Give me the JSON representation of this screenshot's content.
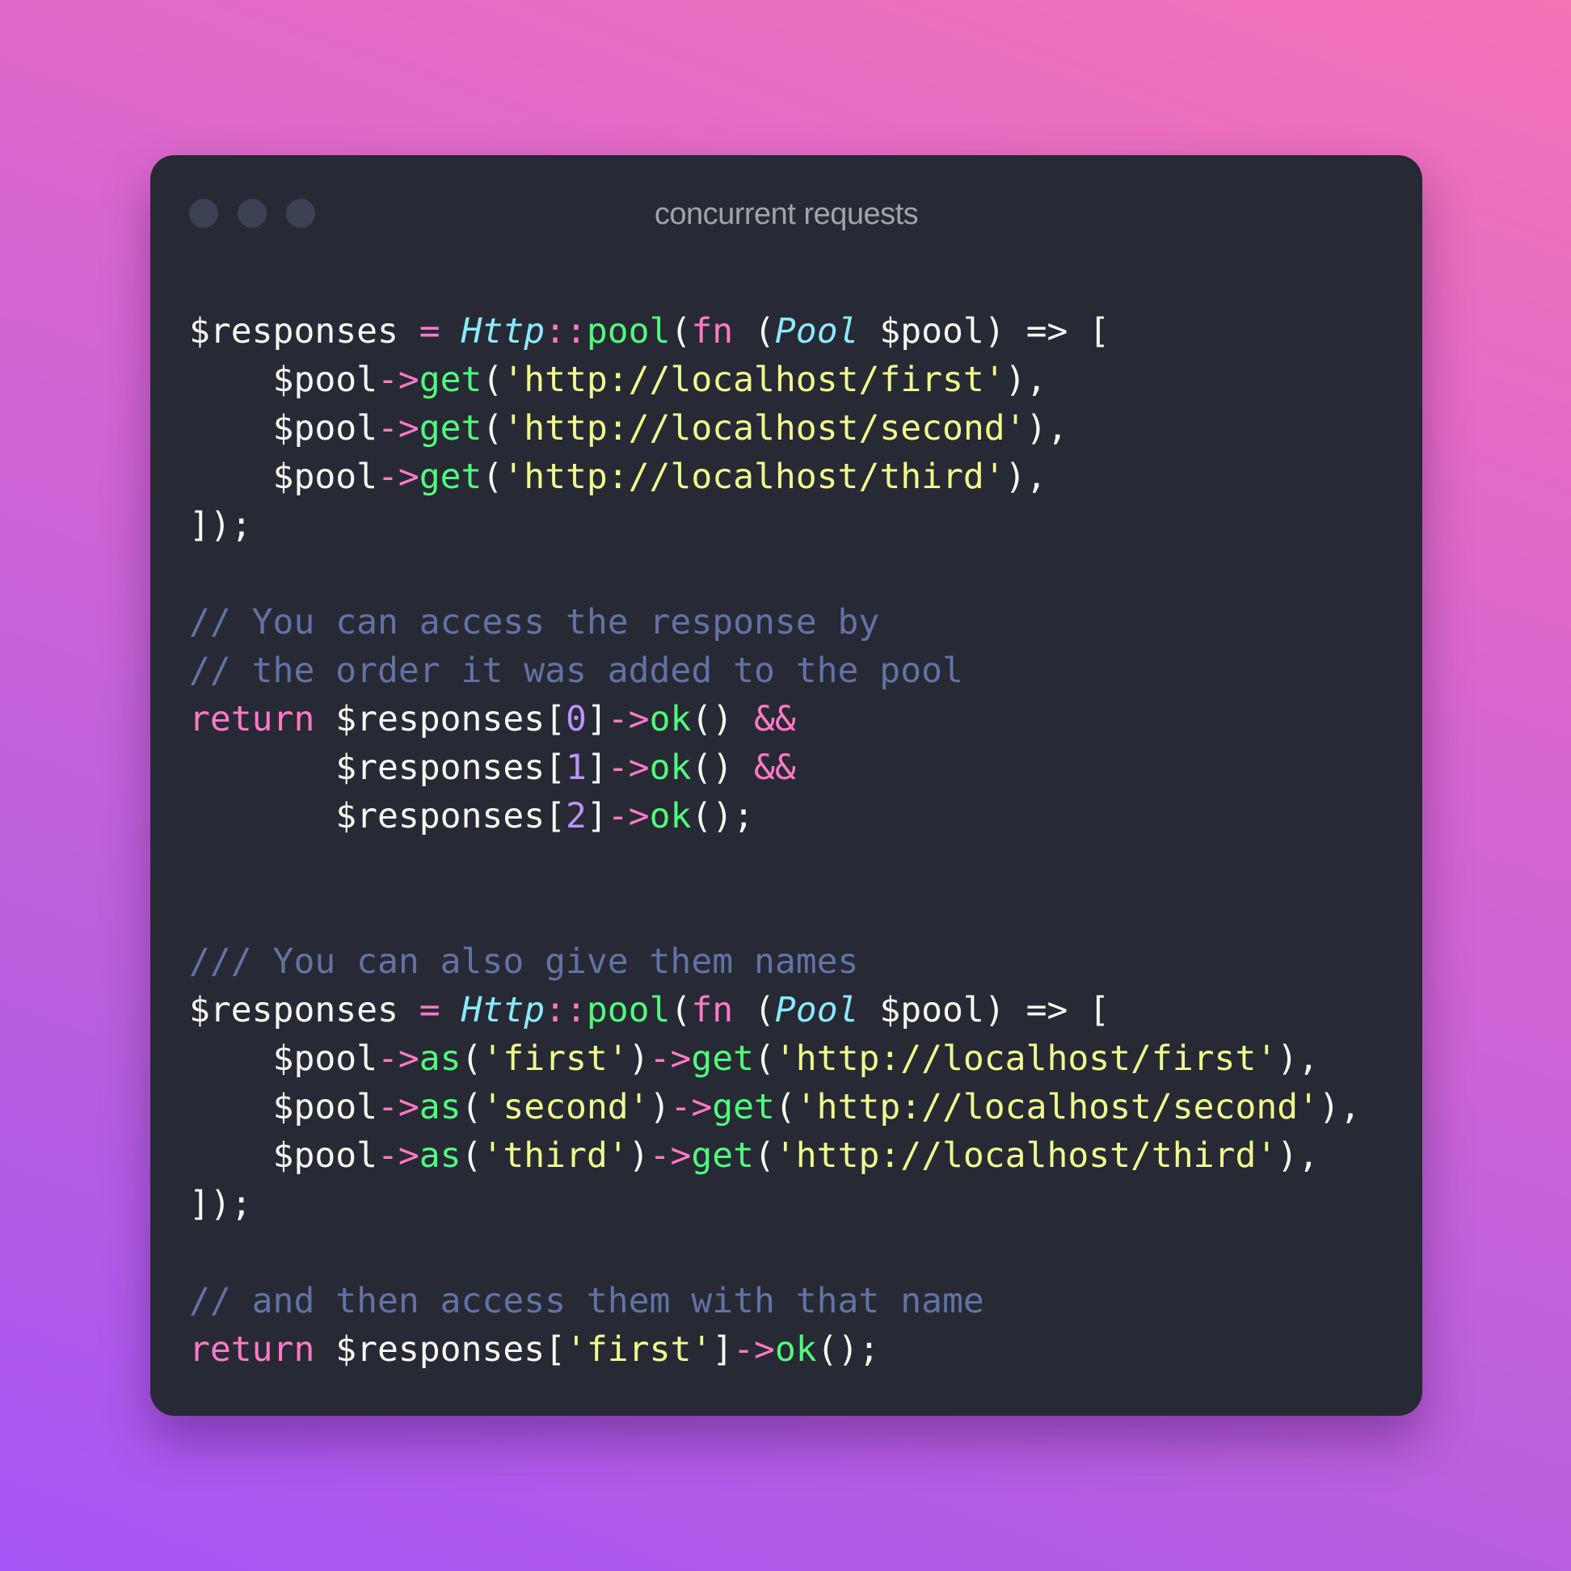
{
  "window": {
    "title": "concurrent requests",
    "buttons": [
      "close",
      "minimize",
      "maximize"
    ]
  },
  "colors": {
    "background_gradient": [
      "#f472b6",
      "#a855f7"
    ],
    "card": "#272a35",
    "plain": "#f8f8f2",
    "comment": "#6272a4",
    "keyword": "#ff79c6",
    "function": "#50fa7b",
    "class": "#8be9fd",
    "string": "#f1fa8c",
    "number": "#bd93f9"
  },
  "code": {
    "language": "php",
    "lines": [
      [
        [
          "plain",
          "$responses "
        ],
        [
          "op",
          "="
        ],
        [
          "plain",
          " "
        ],
        [
          "class",
          "Http"
        ],
        [
          "op",
          "::"
        ],
        [
          "func",
          "pool"
        ],
        [
          "plain",
          "("
        ],
        [
          "keyword",
          "fn"
        ],
        [
          "plain",
          " ("
        ],
        [
          "class",
          "Pool"
        ],
        [
          "plain",
          " $pool) => ["
        ]
      ],
      [
        [
          "plain",
          "    $pool"
        ],
        [
          "op",
          "->"
        ],
        [
          "func",
          "get"
        ],
        [
          "plain",
          "("
        ],
        [
          "string",
          "'http://localhost/first'"
        ],
        [
          "plain",
          "),"
        ]
      ],
      [
        [
          "plain",
          "    $pool"
        ],
        [
          "op",
          "->"
        ],
        [
          "func",
          "get"
        ],
        [
          "plain",
          "("
        ],
        [
          "string",
          "'http://localhost/second'"
        ],
        [
          "plain",
          "),"
        ]
      ],
      [
        [
          "plain",
          "    $pool"
        ],
        [
          "op",
          "->"
        ],
        [
          "func",
          "get"
        ],
        [
          "plain",
          "("
        ],
        [
          "string",
          "'http://localhost/third'"
        ],
        [
          "plain",
          "),"
        ]
      ],
      [
        [
          "plain",
          "]);"
        ]
      ],
      [],
      [
        [
          "comment",
          "// You can access the response by"
        ]
      ],
      [
        [
          "comment",
          "// the order it was added to the pool"
        ]
      ],
      [
        [
          "keyword",
          "return"
        ],
        [
          "plain",
          " $responses["
        ],
        [
          "number",
          "0"
        ],
        [
          "plain",
          "]"
        ],
        [
          "op",
          "->"
        ],
        [
          "func",
          "ok"
        ],
        [
          "plain",
          "() "
        ],
        [
          "op",
          "&&"
        ]
      ],
      [
        [
          "plain",
          "       $responses["
        ],
        [
          "number",
          "1"
        ],
        [
          "plain",
          "]"
        ],
        [
          "op",
          "->"
        ],
        [
          "func",
          "ok"
        ],
        [
          "plain",
          "() "
        ],
        [
          "op",
          "&&"
        ]
      ],
      [
        [
          "plain",
          "       $responses["
        ],
        [
          "number",
          "2"
        ],
        [
          "plain",
          "]"
        ],
        [
          "op",
          "->"
        ],
        [
          "func",
          "ok"
        ],
        [
          "plain",
          "();"
        ]
      ],
      [],
      [],
      [
        [
          "comment",
          "/// You can also give them names"
        ]
      ],
      [
        [
          "plain",
          "$responses "
        ],
        [
          "op",
          "="
        ],
        [
          "plain",
          " "
        ],
        [
          "class",
          "Http"
        ],
        [
          "op",
          "::"
        ],
        [
          "func",
          "pool"
        ],
        [
          "plain",
          "("
        ],
        [
          "keyword",
          "fn"
        ],
        [
          "plain",
          " ("
        ],
        [
          "class",
          "Pool"
        ],
        [
          "plain",
          " $pool) => ["
        ]
      ],
      [
        [
          "plain",
          "    $pool"
        ],
        [
          "op",
          "->"
        ],
        [
          "func",
          "as"
        ],
        [
          "plain",
          "("
        ],
        [
          "string",
          "'first'"
        ],
        [
          "plain",
          ")"
        ],
        [
          "op",
          "->"
        ],
        [
          "func",
          "get"
        ],
        [
          "plain",
          "("
        ],
        [
          "string",
          "'http://localhost/first'"
        ],
        [
          "plain",
          "),"
        ]
      ],
      [
        [
          "plain",
          "    $pool"
        ],
        [
          "op",
          "->"
        ],
        [
          "func",
          "as"
        ],
        [
          "plain",
          "("
        ],
        [
          "string",
          "'second'"
        ],
        [
          "plain",
          ")"
        ],
        [
          "op",
          "->"
        ],
        [
          "func",
          "get"
        ],
        [
          "plain",
          "("
        ],
        [
          "string",
          "'http://localhost/second'"
        ],
        [
          "plain",
          "),"
        ]
      ],
      [
        [
          "plain",
          "    $pool"
        ],
        [
          "op",
          "->"
        ],
        [
          "func",
          "as"
        ],
        [
          "plain",
          "("
        ],
        [
          "string",
          "'third'"
        ],
        [
          "plain",
          ")"
        ],
        [
          "op",
          "->"
        ],
        [
          "func",
          "get"
        ],
        [
          "plain",
          "("
        ],
        [
          "string",
          "'http://localhost/third'"
        ],
        [
          "plain",
          "),"
        ]
      ],
      [
        [
          "plain",
          "]);"
        ]
      ],
      [],
      [
        [
          "comment",
          "// and then access them with that name"
        ]
      ],
      [
        [
          "keyword",
          "return"
        ],
        [
          "plain",
          " $responses["
        ],
        [
          "string",
          "'first'"
        ],
        [
          "plain",
          "]"
        ],
        [
          "op",
          "->"
        ],
        [
          "func",
          "ok"
        ],
        [
          "plain",
          "();"
        ]
      ]
    ]
  }
}
